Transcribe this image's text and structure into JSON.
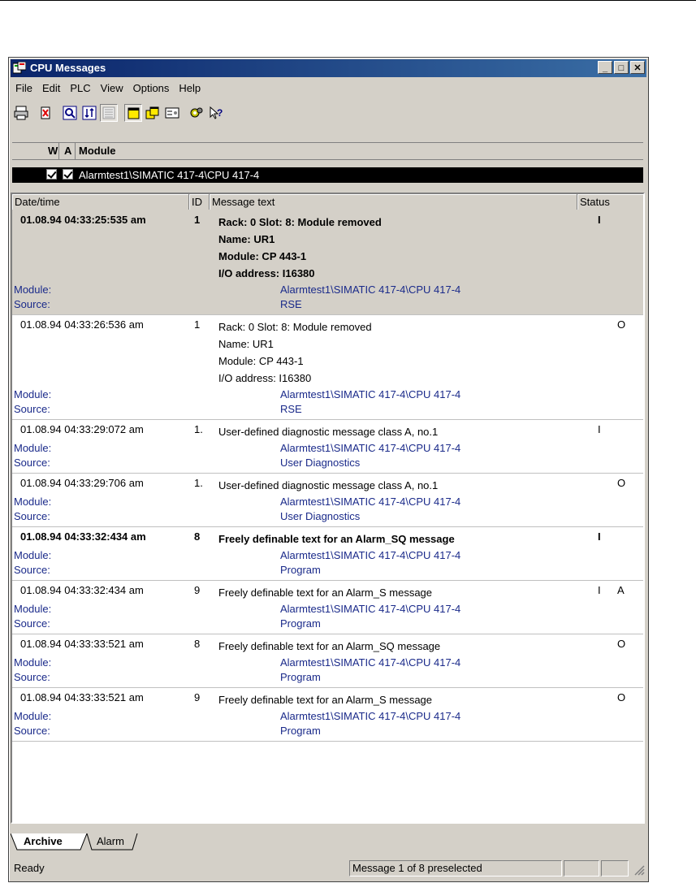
{
  "window": {
    "title": "CPU Messages"
  },
  "menu": [
    "File",
    "Edit",
    "PLC",
    "View",
    "Options",
    "Help"
  ],
  "module_list": {
    "headers": {
      "w": "W",
      "a": "A",
      "module": "Module"
    },
    "row": {
      "w_checked": true,
      "a_checked": true,
      "module": "Alarmtest1\\SIMATIC 417-4\\CPU 417-4"
    }
  },
  "columns": {
    "datetime": "Date/time",
    "id": "ID",
    "text": "Message text",
    "status": "Status"
  },
  "labels": {
    "module": "Module:",
    "source": "Source:"
  },
  "messages": [
    {
      "datetime": "01.08.94  04:33:25:535 am",
      "id": "1",
      "text": "Rack: 0 Slot: 8: Module removed",
      "extra": [
        "Name: UR1",
        "Module: CP 443-1",
        "I/O address: I16380"
      ],
      "status1": "I",
      "status2": "",
      "module": "Alarmtest1\\SIMATIC 417-4\\CPU 417-4",
      "source": "RSE",
      "selected": true
    },
    {
      "datetime": "01.08.94  04:33:26:536 am",
      "id": "1",
      "text": "Rack: 0 Slot: 8: Module removed",
      "extra": [
        "Name: UR1",
        "Module: CP 443-1",
        "I/O address: I16380"
      ],
      "status1": "",
      "status2": "O",
      "module": "Alarmtest1\\SIMATIC 417-4\\CPU 417-4",
      "source": "RSE"
    },
    {
      "datetime": "01.08.94  04:33:29:072 am",
      "id": "1.",
      "text": "User-defined diagnostic message class A, no.1",
      "extra": [],
      "status1": "I",
      "status2": "",
      "module": "Alarmtest1\\SIMATIC 417-4\\CPU 417-4",
      "source": "User Diagnostics"
    },
    {
      "datetime": "01.08.94  04:33:29:706 am",
      "id": "1.",
      "text": "User-defined diagnostic message class A, no.1",
      "extra": [],
      "status1": "",
      "status2": "O",
      "module": "Alarmtest1\\SIMATIC 417-4\\CPU 417-4",
      "source": "User Diagnostics"
    },
    {
      "datetime": "01.08.94  04:33:32:434 am",
      "id": "8",
      "text": "Freely definable text for an Alarm_SQ message",
      "extra": [],
      "status1": "I",
      "status2": "",
      "module": "Alarmtest1\\SIMATIC 417-4\\CPU 417-4",
      "source": "Program",
      "bold": true
    },
    {
      "datetime": "01.08.94  04:33:32:434 am",
      "id": "9",
      "text": "Freely definable text for an Alarm_S message",
      "extra": [],
      "status1": "I",
      "status2": "A",
      "module": "Alarmtest1\\SIMATIC 417-4\\CPU 417-4",
      "source": "Program"
    },
    {
      "datetime": "01.08.94  04:33:33:521 am",
      "id": "8",
      "text": "Freely definable text for an Alarm_SQ message",
      "extra": [],
      "status1": "",
      "status2": "O",
      "module": "Alarmtest1\\SIMATIC 417-4\\CPU 417-4",
      "source": "Program"
    },
    {
      "datetime": "01.08.94  04:33:33:521 am",
      "id": "9",
      "text": "Freely definable text for an Alarm_S message",
      "extra": [],
      "status1": "",
      "status2": "O",
      "module": "Alarmtest1\\SIMATIC 417-4\\CPU 417-4",
      "source": "Program"
    }
  ],
  "tabs": [
    "Archive",
    "Alarm"
  ],
  "statusbar": {
    "left": "Ready",
    "middle": "Message 1 of 8 preselected"
  },
  "icons": [
    "print-icon",
    "delete-icon",
    "view-icon",
    "sort-icon",
    "list-icon",
    "window-icon",
    "windows-icon",
    "settings-icon",
    "gear-icon",
    "help-icon"
  ]
}
